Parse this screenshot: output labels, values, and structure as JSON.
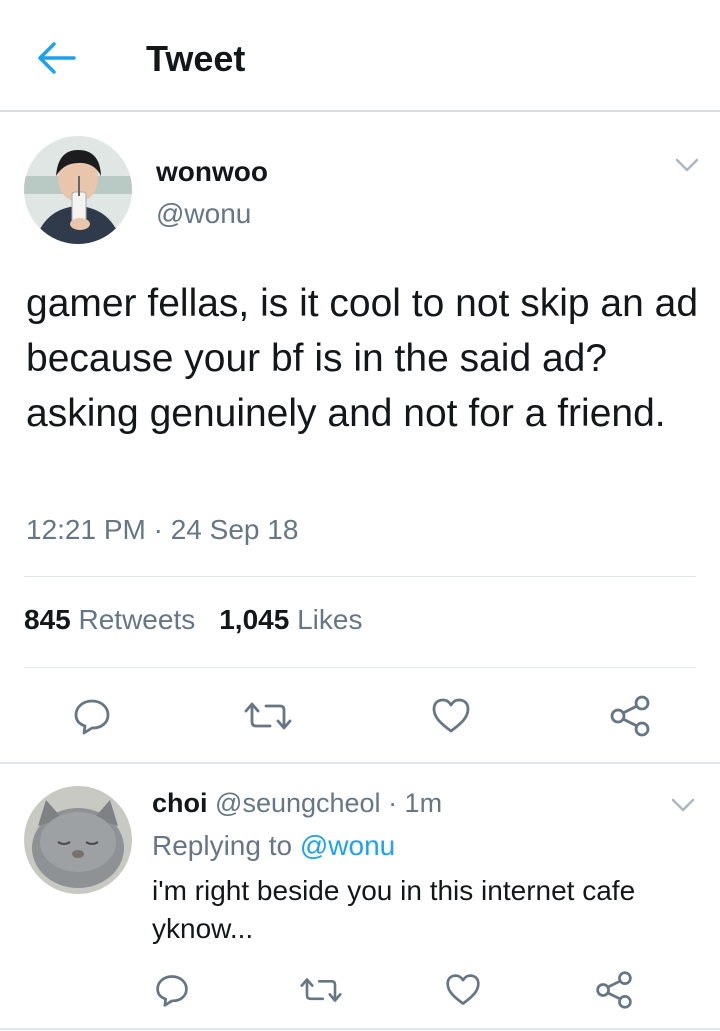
{
  "header": {
    "title": "Tweet",
    "back_icon": "arrow-left-icon"
  },
  "tweet": {
    "name": "wonwoo",
    "handle": "@wonu",
    "text": "gamer fellas, is it cool to not skip an ad because your bf is in the said ad? asking genuinely and not for a friend.",
    "timestamp": "12:21 PM · 24 Sep 18",
    "retweets_count": "845",
    "retweets_label": "Retweets",
    "likes_count": "1,045",
    "likes_label": "Likes"
  },
  "reply": {
    "name": "choi",
    "handle": "@seungcheol",
    "time": " · 1m",
    "replying_prefix": "Replying to ",
    "replying_to": "@wonu",
    "text": "i'm right beside you in this internet cafe yknow..."
  },
  "colors": {
    "accent": "#1da1f2",
    "muted": "#657786",
    "text": "#14171a",
    "divider": "#e1e8ed"
  },
  "actions": [
    "reply-icon",
    "retweet-icon",
    "like-icon",
    "share-icon"
  ]
}
